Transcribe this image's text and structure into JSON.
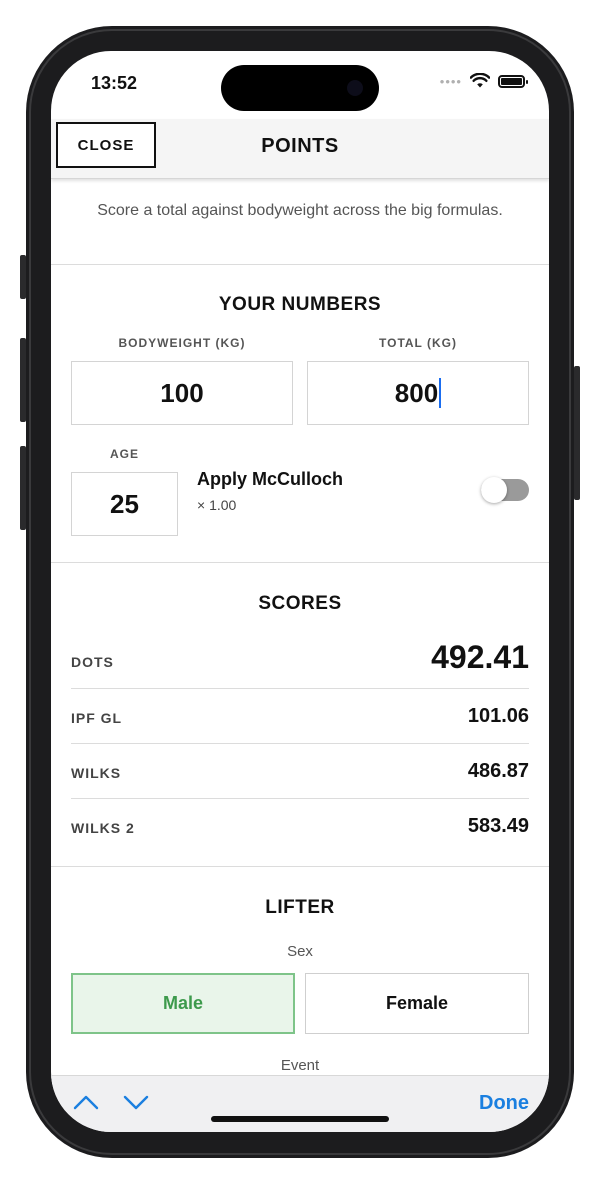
{
  "status": {
    "time": "13:52"
  },
  "header": {
    "close_label": "CLOSE",
    "title": "POINTS"
  },
  "intro": "Score a total against bodyweight across the big formulas.",
  "your_numbers": {
    "title": "YOUR NUMBERS",
    "bodyweight_label": "BODYWEIGHT (KG)",
    "bodyweight_value": "100",
    "total_label": "TOTAL (KG)",
    "total_value": "800",
    "age_label": "AGE",
    "age_value": "25",
    "mcculloch_label": "Apply McCulloch",
    "mcculloch_multiplier": "× 1.00",
    "mcculloch_enabled": false
  },
  "scores": {
    "title": "SCORES",
    "rows": [
      {
        "name": "DOTS",
        "value": "492.41"
      },
      {
        "name": "IPF GL",
        "value": "101.06"
      },
      {
        "name": "WILKS",
        "value": "486.87"
      },
      {
        "name": "WILKS 2",
        "value": "583.49"
      }
    ]
  },
  "lifter": {
    "title": "LIFTER",
    "sex_label": "Sex",
    "sex_options": [
      "Male",
      "Female"
    ],
    "sex_selected": "Male",
    "event_label": "Event"
  },
  "keyboard_toolbar": {
    "done_label": "Done"
  },
  "colors": {
    "accent_blue": "#1a7fe0",
    "selected_green": "#3d9a4c",
    "selected_bg": "#e9f5ea"
  }
}
